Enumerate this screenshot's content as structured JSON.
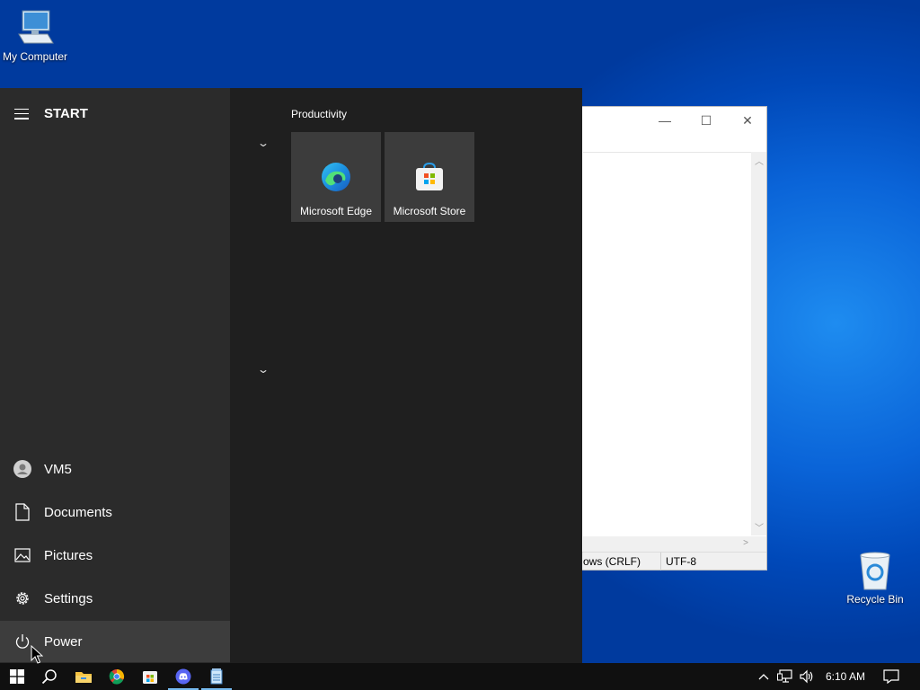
{
  "desktop": {
    "my_computer_label": "My Computer",
    "recycle_bin_label": "Recycle Bin"
  },
  "notepad": {
    "status_line_ending": "ows (CRLF)",
    "status_encoding": "UTF-8",
    "controls": {
      "minimize": "—",
      "maximize": "☐",
      "close": "✕"
    }
  },
  "start_menu": {
    "header_label": "START",
    "left_items": [
      {
        "label": "VM5",
        "icon": "user-icon"
      },
      {
        "label": "Documents",
        "icon": "document-icon"
      },
      {
        "label": "Pictures",
        "icon": "pictures-icon"
      },
      {
        "label": "Settings",
        "icon": "gear-icon"
      },
      {
        "label": "Power",
        "icon": "power-icon"
      }
    ],
    "group_label": "Productivity",
    "tiles": [
      {
        "label": "Microsoft Edge",
        "icon": "edge-icon"
      },
      {
        "label": "Microsoft Store",
        "icon": "store-icon"
      }
    ]
  },
  "taskbar": {
    "apps": [
      "windows-start-icon",
      "search-icon",
      "file-explorer-icon",
      "chrome-icon",
      "store-icon",
      "discord-icon",
      "notepad-icon"
    ],
    "clock": "6:10 AM"
  },
  "colors": {
    "start_left_bg": "#2b2b2b",
    "start_right_bg": "#1f1f1f",
    "tile_bg": "#3c3c3c",
    "taskbar_bg": "#101010",
    "accent": "#76b9ed"
  }
}
